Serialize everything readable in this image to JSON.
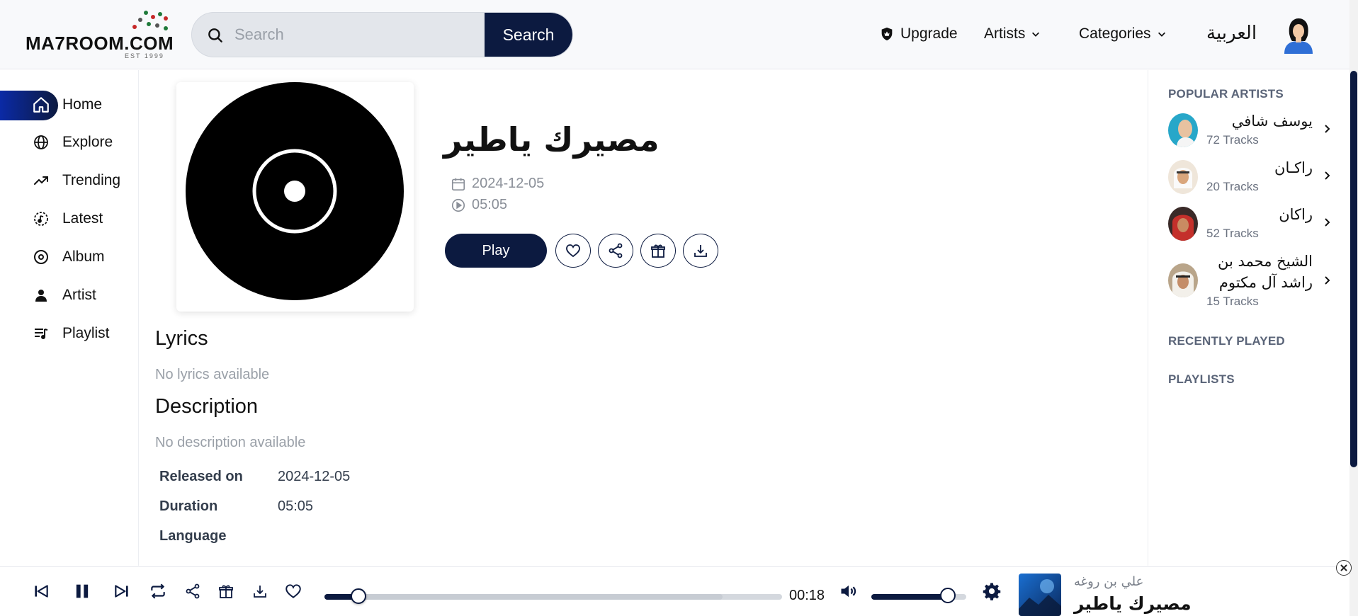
{
  "header": {
    "logo_text": "MA7ROOM.COM",
    "logo_est": "EST 1999",
    "search_placeholder": "Search",
    "search_button": "Search",
    "nav": {
      "upgrade": "Upgrade",
      "artists": "Artists",
      "categories": "Categories",
      "language": "العربية"
    }
  },
  "sidebar": {
    "items": [
      {
        "label": "Home",
        "icon": "home-icon",
        "active": true
      },
      {
        "label": "Explore",
        "icon": "globe-icon"
      },
      {
        "label": "Trending",
        "icon": "trending-icon"
      },
      {
        "label": "Latest",
        "icon": "latest-icon"
      },
      {
        "label": "Album",
        "icon": "album-icon"
      },
      {
        "label": "Artist",
        "icon": "artist-icon"
      },
      {
        "label": "Playlist",
        "icon": "playlist-icon"
      }
    ]
  },
  "song": {
    "title": "مصيرك ياطير",
    "date": "2024-12-05",
    "duration": "05:05",
    "play_label": "Play"
  },
  "lyrics": {
    "heading": "Lyrics",
    "text": "No lyrics available"
  },
  "description": {
    "heading": "Description",
    "text": "No description available"
  },
  "info": {
    "released_label": "Released on",
    "released_value": "2024-12-05",
    "duration_label": "Duration",
    "duration_value": "05:05",
    "language_label": "Language"
  },
  "right": {
    "popular_heading": "POPULAR ARTISTS",
    "artists": [
      {
        "name": "يوسف شافي",
        "tracks": "72 Tracks"
      },
      {
        "name": "راكـان",
        "tracks": "20 Tracks"
      },
      {
        "name": "راكان",
        "tracks": "52 Tracks"
      },
      {
        "name": "الشيخ محمد بن راشد آل مكتوم",
        "tracks": "15 Tracks"
      }
    ],
    "recent_heading": "RECENTLY PLAYED",
    "playlists_heading": "PLAYLISTS"
  },
  "player": {
    "current_time": "00:18",
    "progress_fraction": 0.06,
    "volume_fraction": 0.8,
    "now_playing_artist": "علي بن روغه",
    "now_playing_title": "مصيرك ياطير"
  },
  "colors": {
    "accent": "#0c1a40",
    "muted": "#9aa0a8"
  }
}
